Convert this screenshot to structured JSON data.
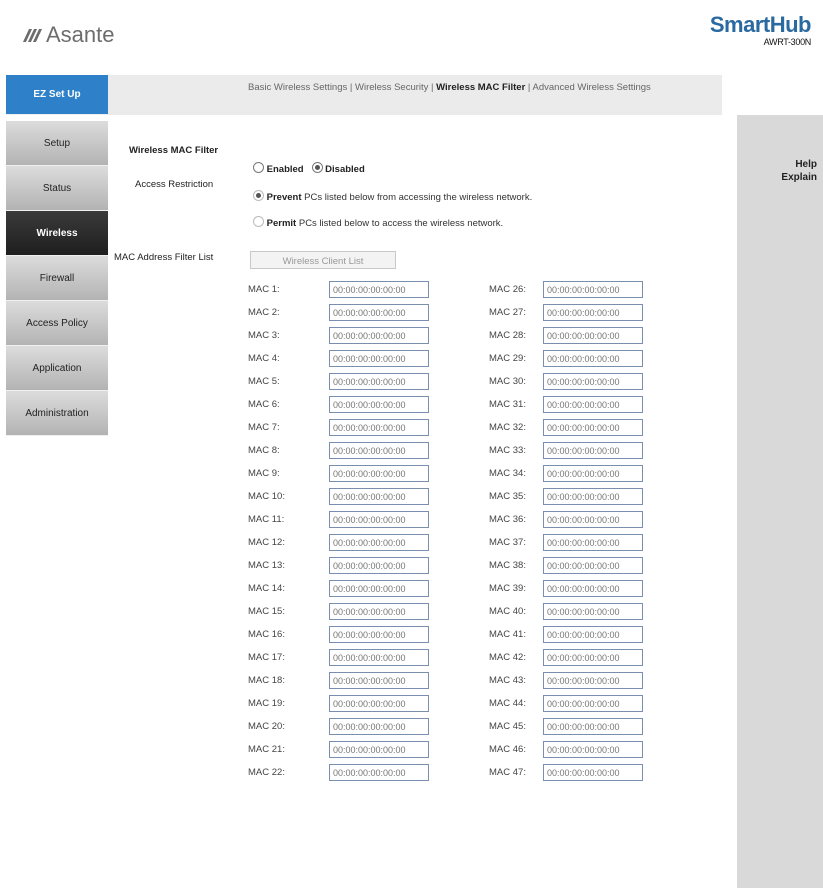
{
  "header": {
    "brand": "Asante",
    "product": "SmartHub",
    "model": "AWRT-300N"
  },
  "sidebar": {
    "items": [
      {
        "label": "EZ Set Up"
      },
      {
        "label": "Setup"
      },
      {
        "label": "Status"
      },
      {
        "label": "Wireless"
      },
      {
        "label": "Firewall"
      },
      {
        "label": "Access Policy"
      },
      {
        "label": "Application"
      },
      {
        "label": "Administration"
      }
    ]
  },
  "subnav": {
    "basic": "Basic Wireless Settings",
    "security": "Wireless Security",
    "mac_filter": "Wireless MAC Filter",
    "advanced": "Advanced Wireless Settings",
    "sep": "|"
  },
  "help": {
    "line1": "Help",
    "line2": "Explain"
  },
  "form": {
    "mac_filter_label": "Wireless MAC Filter",
    "enabled": "Enabled",
    "disabled": "Disabled",
    "access_label": "Access Restriction",
    "prevent_bold": "Prevent",
    "prevent_rest": "PCs listed below from accessing the wireless network.",
    "permit_bold": "Permit",
    "permit_rest": "PCs listed below to access the wireless network.",
    "list_label": "MAC Address Filter List",
    "client_list_button": "Wireless Client List"
  },
  "macs": {
    "placeholder": "00:00:00:00:00:00",
    "left": [
      "MAC 1:",
      "MAC 2:",
      "MAC 3:",
      "MAC 4:",
      "MAC 5:",
      "MAC 6:",
      "MAC 7:",
      "MAC 8:",
      "MAC 9:",
      "MAC 10:",
      "MAC 11:",
      "MAC 12:",
      "MAC 13:",
      "MAC 14:",
      "MAC 15:",
      "MAC 16:",
      "MAC 17:",
      "MAC 18:",
      "MAC 19:",
      "MAC 20:",
      "MAC 21:",
      "MAC 22:"
    ],
    "right": [
      "MAC 26:",
      "MAC 27:",
      "MAC 28:",
      "MAC 29:",
      "MAC 30:",
      "MAC 31:",
      "MAC 32:",
      "MAC 33:",
      "MAC 34:",
      "MAC 35:",
      "MAC 36:",
      "MAC 37:",
      "MAC 38:",
      "MAC 39:",
      "MAC 40:",
      "MAC 41:",
      "MAC 42:",
      "MAC 43:",
      "MAC 44:",
      "MAC 45:",
      "MAC 46:",
      "MAC 47:"
    ]
  }
}
